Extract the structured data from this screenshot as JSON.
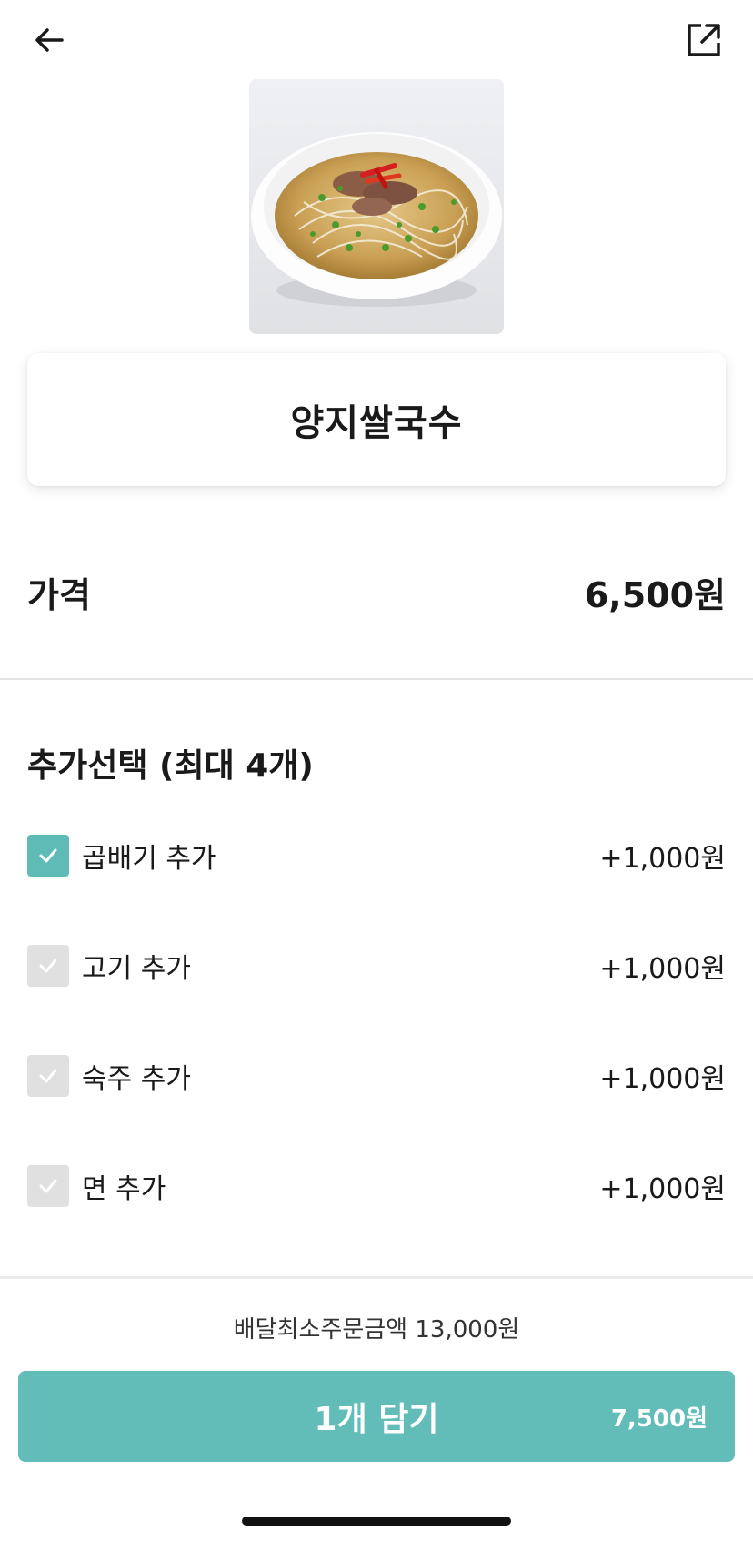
{
  "header": {
    "back_icon": "arrow-left-icon",
    "share_icon": "share-external-icon"
  },
  "product": {
    "name": "양지쌀국수"
  },
  "price": {
    "label": "가격",
    "value": "6,500원"
  },
  "options": {
    "title": "추가선택 (최대 4개)",
    "items": [
      {
        "label": "곱배기 추가",
        "price": "+1,000원",
        "checked": true
      },
      {
        "label": "고기 추가",
        "price": "+1,000원",
        "checked": false
      },
      {
        "label": "숙주 추가",
        "price": "+1,000원",
        "checked": false
      },
      {
        "label": "면 추가",
        "price": "+1,000원",
        "checked": false
      }
    ]
  },
  "footer": {
    "min_order": "배달최소주문금액 13,000원",
    "cart_button_label": "1개 담기",
    "cart_button_price": "7,500원"
  },
  "colors": {
    "accent": "#62bdb8",
    "checkbox_on": "#5fbbb6",
    "checkbox_off": "#e0e0e0"
  }
}
